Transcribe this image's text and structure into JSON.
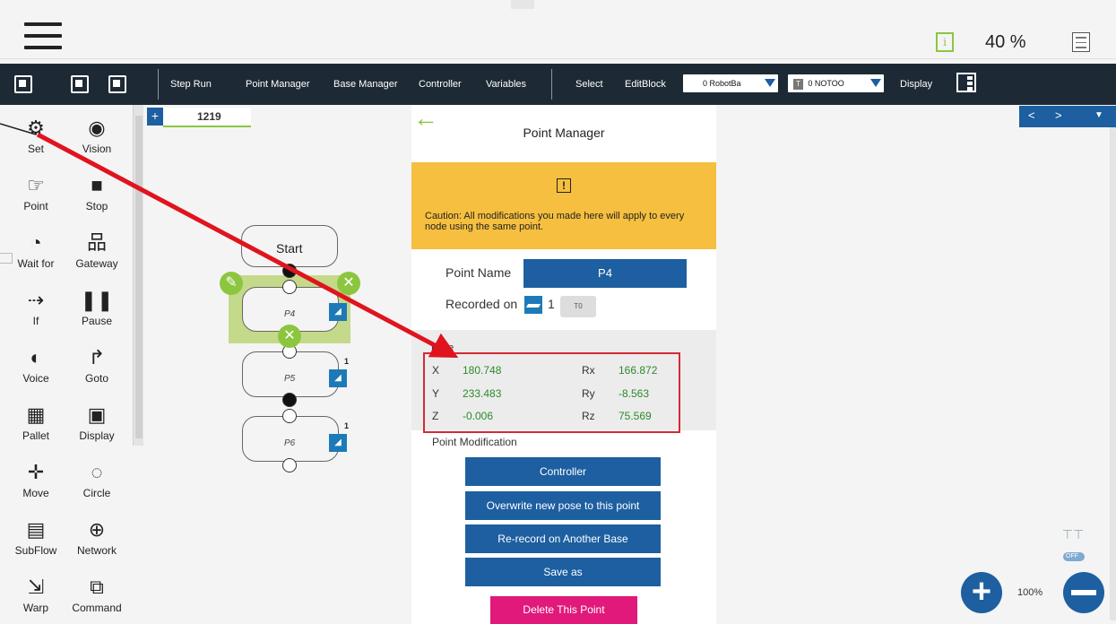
{
  "status_bar": {
    "speed": "40 %",
    "info_icon": "i",
    "icons": [
      "hamburger-menu-icon",
      "info-icon",
      "log-icon"
    ]
  },
  "toolbar": {
    "items": [
      "Step Run",
      "Point Manager",
      "Base Manager",
      "Controller",
      "Variables",
      "Select",
      "EditBlock",
      "Display"
    ],
    "base_select": "0 RobotBa",
    "tool_select_box": "T",
    "tool_select": "0 NOTOO",
    "icons": [
      "new-project-icon",
      "open-project-icon",
      "save-project-icon",
      "display-layout-icon"
    ]
  },
  "palette": {
    "items": [
      {
        "label": "Set",
        "icon": "set-icon"
      },
      {
        "label": "Vision",
        "icon": "vision-icon"
      },
      {
        "label": "Point",
        "icon": "point-icon"
      },
      {
        "label": "Stop",
        "icon": "stop-icon"
      },
      {
        "label": "Wait for",
        "icon": "wait-for-icon"
      },
      {
        "label": "Gateway",
        "icon": "gateway-icon"
      },
      {
        "label": "If",
        "icon": "if-icon"
      },
      {
        "label": "Pause",
        "icon": "pause-icon"
      },
      {
        "label": "Voice",
        "icon": "voice-icon"
      },
      {
        "label": "Goto",
        "icon": "goto-icon"
      },
      {
        "label": "Pallet",
        "icon": "pallet-icon"
      },
      {
        "label": "Display",
        "icon": "display-icon"
      },
      {
        "label": "Move",
        "icon": "move-icon"
      },
      {
        "label": "Circle",
        "icon": "circle-icon"
      },
      {
        "label": "SubFlow",
        "icon": "subflow-icon"
      },
      {
        "label": "Network",
        "icon": "network-icon"
      },
      {
        "label": "Warp",
        "icon": "warp-icon"
      },
      {
        "label": "Command",
        "icon": "command-icon"
      }
    ]
  },
  "canvas": {
    "tab_plus": "+",
    "tab_title": "1219",
    "start_label": "Start",
    "nodes": [
      "P4",
      "P5",
      "P6"
    ],
    "base_counts": [
      "1",
      "1"
    ],
    "zoom_level": "100%",
    "nav_prev": "<",
    "nav_next": ">",
    "toggle_state": "OFF"
  },
  "point_manager": {
    "title": "Point Manager",
    "caution_icon": "!",
    "caution_text": "Caution: All modifications you made here will apply to every node using the same point.",
    "point_name_label": "Point Name",
    "point_name_value": "P4",
    "recorded_on_label": "Recorded on",
    "recorded_base": "1",
    "recorded_tool": "T0",
    "pose_label": "Pose",
    "pose": {
      "X": "180.748",
      "Y": "233.483",
      "Z": "-0.006",
      "Rx": "166.872",
      "Ry": "-8.563",
      "Rz": "75.569"
    },
    "modification_label": "Point Modification",
    "buttons": [
      "Controller",
      "Overwrite new pose to this point",
      "Re-record on Another Base",
      "Save as"
    ],
    "delete_button": "Delete This Point"
  },
  "colors": {
    "toolbar_bg": "#1d2a35",
    "accent_blue": "#1d5fa0",
    "caution_yellow": "#f6bf3f",
    "delete_pink": "#e0197a",
    "node_selected": "#8cc63f",
    "annotation_red": "#e0141e"
  }
}
